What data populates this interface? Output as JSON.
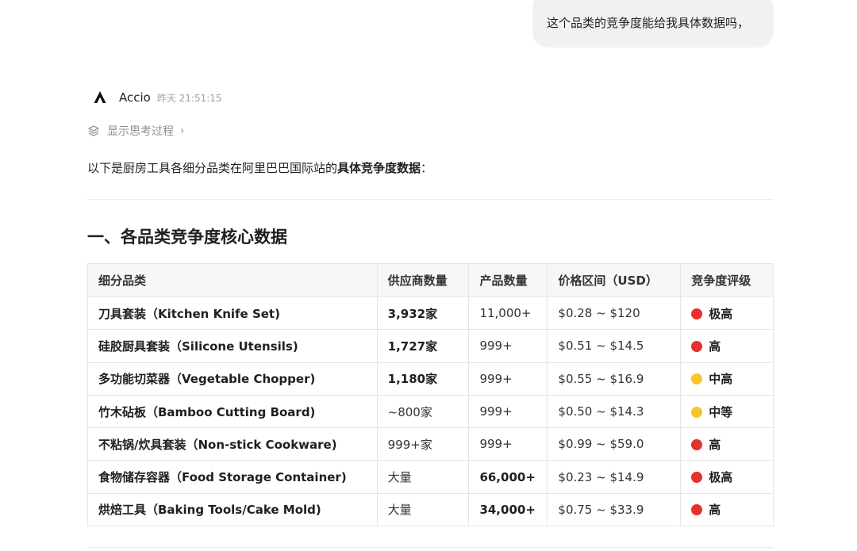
{
  "user_message": "这个品类的竞争度能给我具体数据吗，",
  "assistant": {
    "name": "Accio",
    "timestamp": "昨天 21:51:15",
    "thinking_toggle": "显示思考过程",
    "intro_prefix": "以下是厨房工具各细分品类在阿里巴巴国际站的",
    "intro_bold": "具体竞争度数据",
    "intro_suffix": "："
  },
  "section_title": "一、各品类竞争度核心数据",
  "table": {
    "headers": [
      "细分品类",
      "供应商数量",
      "产品数量",
      "价格区间（USD）",
      "竞争度评级"
    ],
    "rows": [
      {
        "category": "刀具套装（Kitchen Knife Set)",
        "suppliers": "3,932家",
        "suppliers_bold": true,
        "products": "11,000+",
        "products_bold": false,
        "price": "$0.28 ~ $120",
        "rating": "极高",
        "rating_color": "#e8302c"
      },
      {
        "category": "硅胶厨具套装（Silicone Utensils)",
        "suppliers": "1,727家",
        "suppliers_bold": true,
        "products": "999+",
        "products_bold": false,
        "price": "$0.51 ~ $14.5",
        "rating": "高",
        "rating_color": "#e8302c"
      },
      {
        "category": "多功能切菜器（Vegetable Chopper)",
        "suppliers": "1,180家",
        "suppliers_bold": true,
        "products": "999+",
        "products_bold": false,
        "price": "$0.55 ~ $16.9",
        "rating": "中高",
        "rating_color": "#f5c52b"
      },
      {
        "category": "竹木砧板（Bamboo Cutting Board)",
        "suppliers": "~800家",
        "suppliers_bold": false,
        "products": "999+",
        "products_bold": false,
        "price": "$0.50 ~ $14.3",
        "rating": "中等",
        "rating_color": "#f5c52b"
      },
      {
        "category": "不粘锅/炊具套装（Non-stick Cookware)",
        "suppliers": "999+家",
        "suppliers_bold": false,
        "products": "999+",
        "products_bold": false,
        "price": "$0.99 ~ $59.0",
        "rating": "高",
        "rating_color": "#e8302c"
      },
      {
        "category": "食物储存容器（Food Storage Container)",
        "suppliers": "大量",
        "suppliers_bold": false,
        "products": "66,000+",
        "products_bold": true,
        "price": "$0.23 ~ $14.9",
        "rating": "极高",
        "rating_color": "#e8302c"
      },
      {
        "category": "烘焙工具（Baking Tools/Cake Mold)",
        "suppliers": "大量",
        "suppliers_bold": false,
        "products": "34,000+",
        "products_bold": true,
        "price": "$0.75 ~ $33.9",
        "rating": "高",
        "rating_color": "#e8302c"
      }
    ]
  }
}
